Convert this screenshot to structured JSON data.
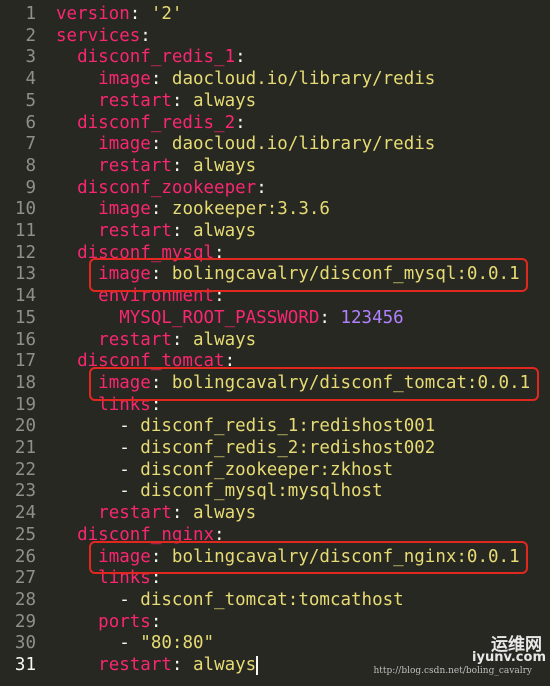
{
  "editor": {
    "lines": [
      {
        "n": "1",
        "tokens": [
          {
            "t": "version",
            "c": "key"
          },
          {
            "t": ": ",
            "c": "plain"
          },
          {
            "t": "'2'",
            "c": "str"
          }
        ]
      },
      {
        "n": "2",
        "tokens": [
          {
            "t": "services",
            "c": "key"
          },
          {
            "t": ":",
            "c": "plain"
          }
        ]
      },
      {
        "n": "3",
        "tokens": [
          {
            "t": "  ",
            "c": "plain"
          },
          {
            "t": "disconf_redis_1",
            "c": "key"
          },
          {
            "t": ":",
            "c": "plain"
          }
        ]
      },
      {
        "n": "4",
        "tokens": [
          {
            "t": "    ",
            "c": "plain"
          },
          {
            "t": "image",
            "c": "key"
          },
          {
            "t": ": ",
            "c": "plain"
          },
          {
            "t": "daocloud.io/library/redis",
            "c": "str"
          }
        ]
      },
      {
        "n": "5",
        "tokens": [
          {
            "t": "    ",
            "c": "plain"
          },
          {
            "t": "restart",
            "c": "key"
          },
          {
            "t": ": ",
            "c": "plain"
          },
          {
            "t": "always",
            "c": "str"
          }
        ]
      },
      {
        "n": "6",
        "tokens": [
          {
            "t": "  ",
            "c": "plain"
          },
          {
            "t": "disconf_redis_2",
            "c": "key"
          },
          {
            "t": ":",
            "c": "plain"
          }
        ]
      },
      {
        "n": "7",
        "tokens": [
          {
            "t": "    ",
            "c": "plain"
          },
          {
            "t": "image",
            "c": "key"
          },
          {
            "t": ": ",
            "c": "plain"
          },
          {
            "t": "daocloud.io/library/redis",
            "c": "str"
          }
        ]
      },
      {
        "n": "8",
        "tokens": [
          {
            "t": "    ",
            "c": "plain"
          },
          {
            "t": "restart",
            "c": "key"
          },
          {
            "t": ": ",
            "c": "plain"
          },
          {
            "t": "always",
            "c": "str"
          }
        ]
      },
      {
        "n": "9",
        "tokens": [
          {
            "t": "  ",
            "c": "plain"
          },
          {
            "t": "disconf_zookeeper",
            "c": "key"
          },
          {
            "t": ":",
            "c": "plain"
          }
        ]
      },
      {
        "n": "10",
        "tokens": [
          {
            "t": "    ",
            "c": "plain"
          },
          {
            "t": "image",
            "c": "key"
          },
          {
            "t": ": ",
            "c": "plain"
          },
          {
            "t": "zookeeper:3.3.6",
            "c": "str"
          }
        ]
      },
      {
        "n": "11",
        "tokens": [
          {
            "t": "    ",
            "c": "plain"
          },
          {
            "t": "restart",
            "c": "key"
          },
          {
            "t": ": ",
            "c": "plain"
          },
          {
            "t": "always",
            "c": "str"
          }
        ]
      },
      {
        "n": "12",
        "tokens": [
          {
            "t": "  ",
            "c": "plain"
          },
          {
            "t": "disconf_mysql",
            "c": "key"
          },
          {
            "t": ":",
            "c": "plain"
          }
        ]
      },
      {
        "n": "13",
        "tokens": [
          {
            "t": "    ",
            "c": "plain"
          },
          {
            "t": "image",
            "c": "key"
          },
          {
            "t": ": ",
            "c": "plain"
          },
          {
            "t": "bolingcavalry/disconf_mysql:0.0.1",
            "c": "str"
          }
        ],
        "boxed": true
      },
      {
        "n": "14",
        "tokens": [
          {
            "t": "    ",
            "c": "plain"
          },
          {
            "t": "environment",
            "c": "key"
          },
          {
            "t": ":",
            "c": "plain"
          }
        ]
      },
      {
        "n": "15",
        "tokens": [
          {
            "t": "      ",
            "c": "plain"
          },
          {
            "t": "MYSQL_ROOT_PASSWORD",
            "c": "key"
          },
          {
            "t": ": ",
            "c": "plain"
          },
          {
            "t": "123456",
            "c": "num"
          }
        ]
      },
      {
        "n": "16",
        "tokens": [
          {
            "t": "    ",
            "c": "plain"
          },
          {
            "t": "restart",
            "c": "key"
          },
          {
            "t": ": ",
            "c": "plain"
          },
          {
            "t": "always",
            "c": "str"
          }
        ]
      },
      {
        "n": "17",
        "tokens": [
          {
            "t": "  ",
            "c": "plain"
          },
          {
            "t": "disconf_tomcat",
            "c": "key"
          },
          {
            "t": ":",
            "c": "plain"
          }
        ]
      },
      {
        "n": "18",
        "tokens": [
          {
            "t": "    ",
            "c": "plain"
          },
          {
            "t": "image",
            "c": "key"
          },
          {
            "t": ": ",
            "c": "plain"
          },
          {
            "t": "bolingcavalry/disconf_tomcat:0.0.1",
            "c": "str"
          }
        ],
        "boxed": true
      },
      {
        "n": "19",
        "tokens": [
          {
            "t": "    ",
            "c": "plain"
          },
          {
            "t": "links",
            "c": "key"
          },
          {
            "t": ":",
            "c": "plain"
          }
        ]
      },
      {
        "n": "20",
        "tokens": [
          {
            "t": "      - ",
            "c": "plain"
          },
          {
            "t": "disconf_redis_1:redishost001",
            "c": "str"
          }
        ]
      },
      {
        "n": "21",
        "tokens": [
          {
            "t": "      - ",
            "c": "plain"
          },
          {
            "t": "disconf_redis_2:redishost002",
            "c": "str"
          }
        ]
      },
      {
        "n": "22",
        "tokens": [
          {
            "t": "      - ",
            "c": "plain"
          },
          {
            "t": "disconf_zookeeper:zkhost",
            "c": "str"
          }
        ]
      },
      {
        "n": "23",
        "tokens": [
          {
            "t": "      - ",
            "c": "plain"
          },
          {
            "t": "disconf_mysql:mysqlhost",
            "c": "str"
          }
        ]
      },
      {
        "n": "24",
        "tokens": [
          {
            "t": "    ",
            "c": "plain"
          },
          {
            "t": "restart",
            "c": "key"
          },
          {
            "t": ": ",
            "c": "plain"
          },
          {
            "t": "always",
            "c": "str"
          }
        ]
      },
      {
        "n": "25",
        "tokens": [
          {
            "t": "  ",
            "c": "plain"
          },
          {
            "t": "disconf_nginx",
            "c": "key"
          },
          {
            "t": ":",
            "c": "plain"
          }
        ]
      },
      {
        "n": "26",
        "tokens": [
          {
            "t": "    ",
            "c": "plain"
          },
          {
            "t": "image",
            "c": "key"
          },
          {
            "t": ": ",
            "c": "plain"
          },
          {
            "t": "bolingcavalry/disconf_nginx:0.0.1",
            "c": "str"
          }
        ],
        "boxed": true
      },
      {
        "n": "27",
        "tokens": [
          {
            "t": "    ",
            "c": "plain"
          },
          {
            "t": "links",
            "c": "key"
          },
          {
            "t": ":",
            "c": "plain"
          }
        ]
      },
      {
        "n": "28",
        "tokens": [
          {
            "t": "      - ",
            "c": "plain"
          },
          {
            "t": "disconf_tomcat:tomcathost",
            "c": "str"
          }
        ]
      },
      {
        "n": "29",
        "tokens": [
          {
            "t": "    ",
            "c": "plain"
          },
          {
            "t": "ports",
            "c": "key"
          },
          {
            "t": ":",
            "c": "plain"
          }
        ]
      },
      {
        "n": "30",
        "tokens": [
          {
            "t": "      - ",
            "c": "plain"
          },
          {
            "t": "\"80:80\"",
            "c": "str"
          }
        ]
      },
      {
        "n": "31",
        "tokens": [
          {
            "t": "    ",
            "c": "plain"
          },
          {
            "t": "restart",
            "c": "key"
          },
          {
            "t": ": ",
            "c": "plain"
          },
          {
            "t": "always",
            "c": "str"
          }
        ],
        "active": true
      }
    ]
  },
  "watermark": {
    "cn": "运维网",
    "site": "iyunv.com",
    "url": "http://blog.csdn.net/boling_cavalry"
  },
  "colors": {
    "background": "#272822",
    "key": "#f92672",
    "string": "#e6db74",
    "number": "#ae81ff",
    "highlight_box": "#e0281f"
  }
}
